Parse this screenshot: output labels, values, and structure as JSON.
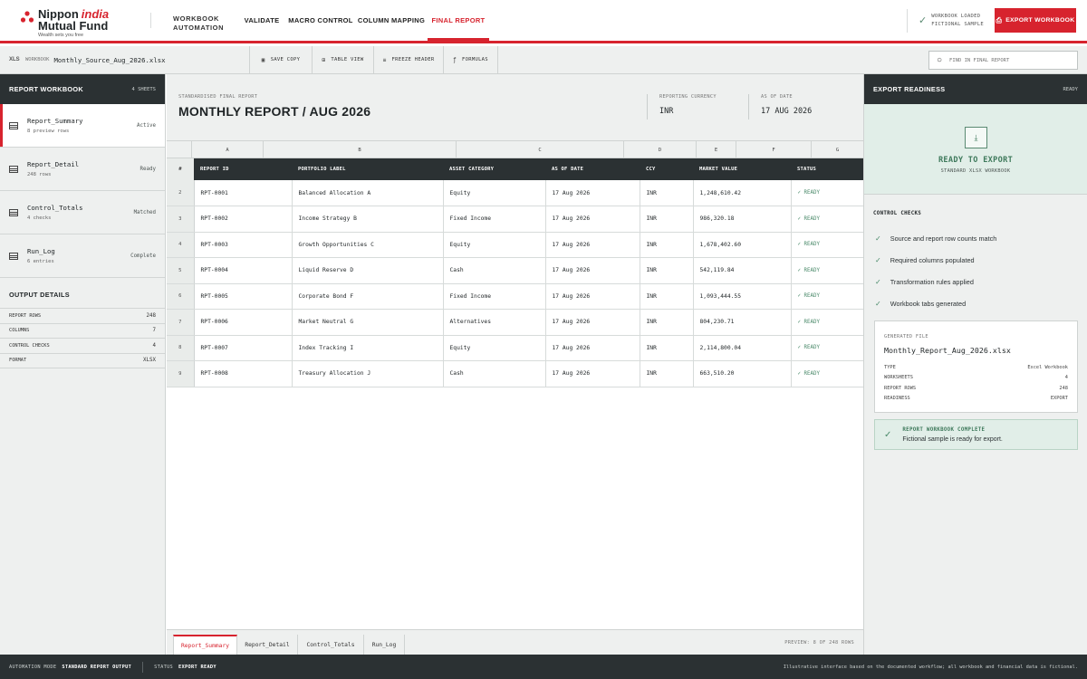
{
  "brand": {
    "line1": "Nippon",
    "line1_accent": "india",
    "line2": "Mutual Fund",
    "tagline": "Wealth sets you free"
  },
  "app": {
    "name_line1": "WORKBOOK",
    "name_line2": "AUTOMATION"
  },
  "nav": {
    "tabs": [
      {
        "label": "VALIDATE"
      },
      {
        "label": "MACRO CONTROL"
      },
      {
        "label": "COLUMN MAPPING"
      },
      {
        "label": "FINAL REPORT",
        "active": true
      }
    ]
  },
  "status_top": {
    "line1": "WORKBOOK LOADED",
    "line2": "FICTIONAL SAMPLE"
  },
  "export_button": "EXPORT WORKBOOK",
  "toolbar": {
    "workbook_label": "WORKBOOK",
    "file_name": "Monthly_Source_Aug_2026.xlsx",
    "file_icon": "XLS",
    "save_copy": "SAVE COPY",
    "table_view": "TABLE VIEW",
    "freeze_header": "FREEZE HEADER",
    "formulas": "FORMULAS",
    "find_placeholder": "FIND IN FINAL REPORT"
  },
  "left": {
    "title": "REPORT WORKBOOK",
    "count": "4 SHEETS",
    "sheets": [
      {
        "name": "Report_Summary",
        "sub": "8 preview rows",
        "status": "Active"
      },
      {
        "name": "Report_Detail",
        "sub": "248 rows",
        "status": "Ready"
      },
      {
        "name": "Control_Totals",
        "sub": "4 checks",
        "status": "Matched"
      },
      {
        "name": "Run_Log",
        "sub": "6 entries",
        "status": "Complete"
      }
    ],
    "output_title": "OUTPUT DETAILS",
    "output": [
      {
        "k": "REPORT ROWS",
        "v": "248"
      },
      {
        "k": "COLUMNS",
        "v": "7"
      },
      {
        "k": "CONTROL CHECKS",
        "v": "4"
      },
      {
        "k": "FORMAT",
        "v": "XLSX"
      }
    ]
  },
  "report": {
    "kicker": "STANDARDISED FINAL REPORT",
    "title": "MONTHLY REPORT / AUG 2026",
    "currency_label": "REPORTING CURRENCY",
    "currency": "INR",
    "asof_label": "AS OF DATE",
    "asof": "17 AUG 2026",
    "col_letters": [
      "A",
      "B",
      "C",
      "D",
      "E",
      "F",
      "G"
    ],
    "headers": [
      "#",
      "REPORT ID",
      "PORTFOLIO LABEL",
      "ASSET CATEGORY",
      "AS OF DATE",
      "CCY",
      "MARKET VALUE",
      "STATUS"
    ],
    "rows": [
      {
        "n": "2",
        "id": "RPT-0001",
        "label": "Balanced Allocation A",
        "cat": "Equity",
        "date": "17 Aug 2026",
        "ccy": "INR",
        "mv": "1,248,610.42",
        "status": "READY"
      },
      {
        "n": "3",
        "id": "RPT-0002",
        "label": "Income Strategy B",
        "cat": "Fixed Income",
        "date": "17 Aug 2026",
        "ccy": "INR",
        "mv": "986,320.18",
        "status": "READY"
      },
      {
        "n": "4",
        "id": "RPT-0003",
        "label": "Growth Opportunities C",
        "cat": "Equity",
        "date": "17 Aug 2026",
        "ccy": "INR",
        "mv": "1,678,402.60",
        "status": "READY"
      },
      {
        "n": "5",
        "id": "RPT-0004",
        "label": "Liquid Reserve D",
        "cat": "Cash",
        "date": "17 Aug 2026",
        "ccy": "INR",
        "mv": "542,119.84",
        "status": "READY"
      },
      {
        "n": "6",
        "id": "RPT-0005",
        "label": "Corporate Bond F",
        "cat": "Fixed Income",
        "date": "17 Aug 2026",
        "ccy": "INR",
        "mv": "1,093,444.55",
        "status": "READY"
      },
      {
        "n": "7",
        "id": "RPT-0006",
        "label": "Market Neutral G",
        "cat": "Alternatives",
        "date": "17 Aug 2026",
        "ccy": "INR",
        "mv": "804,230.71",
        "status": "READY"
      },
      {
        "n": "8",
        "id": "RPT-0007",
        "label": "Index Tracking I",
        "cat": "Equity",
        "date": "17 Aug 2026",
        "ccy": "INR",
        "mv": "2,114,800.04",
        "status": "READY"
      },
      {
        "n": "9",
        "id": "RPT-0008",
        "label": "Treasury Allocation J",
        "cat": "Cash",
        "date": "17 Aug 2026",
        "ccy": "INR",
        "mv": "663,510.20",
        "status": "READY"
      }
    ],
    "sheet_tabs": [
      "Report_Summary",
      "Report_Detail",
      "Control_Totals",
      "Run_Log"
    ],
    "preview": "PREVIEW: 8 OF 248 ROWS"
  },
  "right": {
    "title": "EXPORT READINESS",
    "badge": "READY",
    "ready_title": "READY TO EXPORT",
    "ready_sub": "STANDARD XLSX WORKBOOK",
    "checks_title": "CONTROL CHECKS",
    "checks": [
      "Source and report row counts match",
      "Required columns populated",
      "Transformation rules applied",
      "Workbook tabs generated"
    ],
    "gen_label": "GENERATED FILE",
    "gen_file": "Monthly_Report_Aug_2026.xlsx",
    "gen_rows": [
      {
        "k": "TYPE",
        "v": "Excel Workbook"
      },
      {
        "k": "WORKSHEETS",
        "v": "4"
      },
      {
        "k": "REPORT ROWS",
        "v": "248"
      },
      {
        "k": "READINESS",
        "v": "EXPORT"
      }
    ],
    "complete_title": "REPORT WORKBOOK COMPLETE",
    "complete_sub": "Fictional sample is ready for export."
  },
  "footer": {
    "mode_label": "AUTOMATION MODE",
    "mode": "STANDARD REPORT OUTPUT",
    "status_label": "STATUS",
    "status": "EXPORT READY",
    "note": "Illustrative interface based on the documented workflow; all workbook and financial data is fictional."
  },
  "colors": {
    "accent": "#d7232e",
    "dark": "#2b3133",
    "success": "#4a8a6a"
  }
}
